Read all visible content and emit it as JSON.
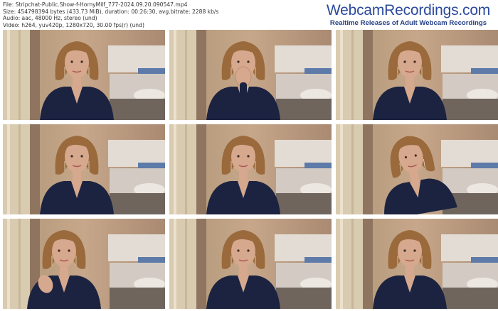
{
  "header": {
    "file_line": "File: Stripchat-Public.Show-f-HornyMilf_777-2024.09.20.090547.mp4",
    "size_line": "Size: 454798394 bytes (433.73 MiB), duration: 00:26:30, avg.bitrate: 2288 kb/s",
    "audio_line": "Audio: aac, 48000 Hz, stereo (und)",
    "video_line": "Video: h264, yuv420p, 1280x720, 30.00 fps(r) (und)"
  },
  "brand": {
    "name": "WebcamRecordings.com",
    "tagline": "Realtime Releases of Adult Webcam Recordings"
  },
  "thumbnails": [
    {
      "pose": "neutral"
    },
    {
      "pose": "hand-on-face"
    },
    {
      "pose": "neutral"
    },
    {
      "pose": "neutral"
    },
    {
      "pose": "neutral"
    },
    {
      "pose": "head-tilt"
    },
    {
      "pose": "hand-raised"
    },
    {
      "pose": "neutral"
    },
    {
      "pose": "neutral"
    }
  ],
  "colors": {
    "brand_blue": "#2b4a9b",
    "curtain": "#d9cbb0",
    "wall": "#c7a78a",
    "sofa": "#e3dcd4",
    "hair": "#9a6a3c",
    "skin": "#d6a88d",
    "top": "#1b2340"
  }
}
